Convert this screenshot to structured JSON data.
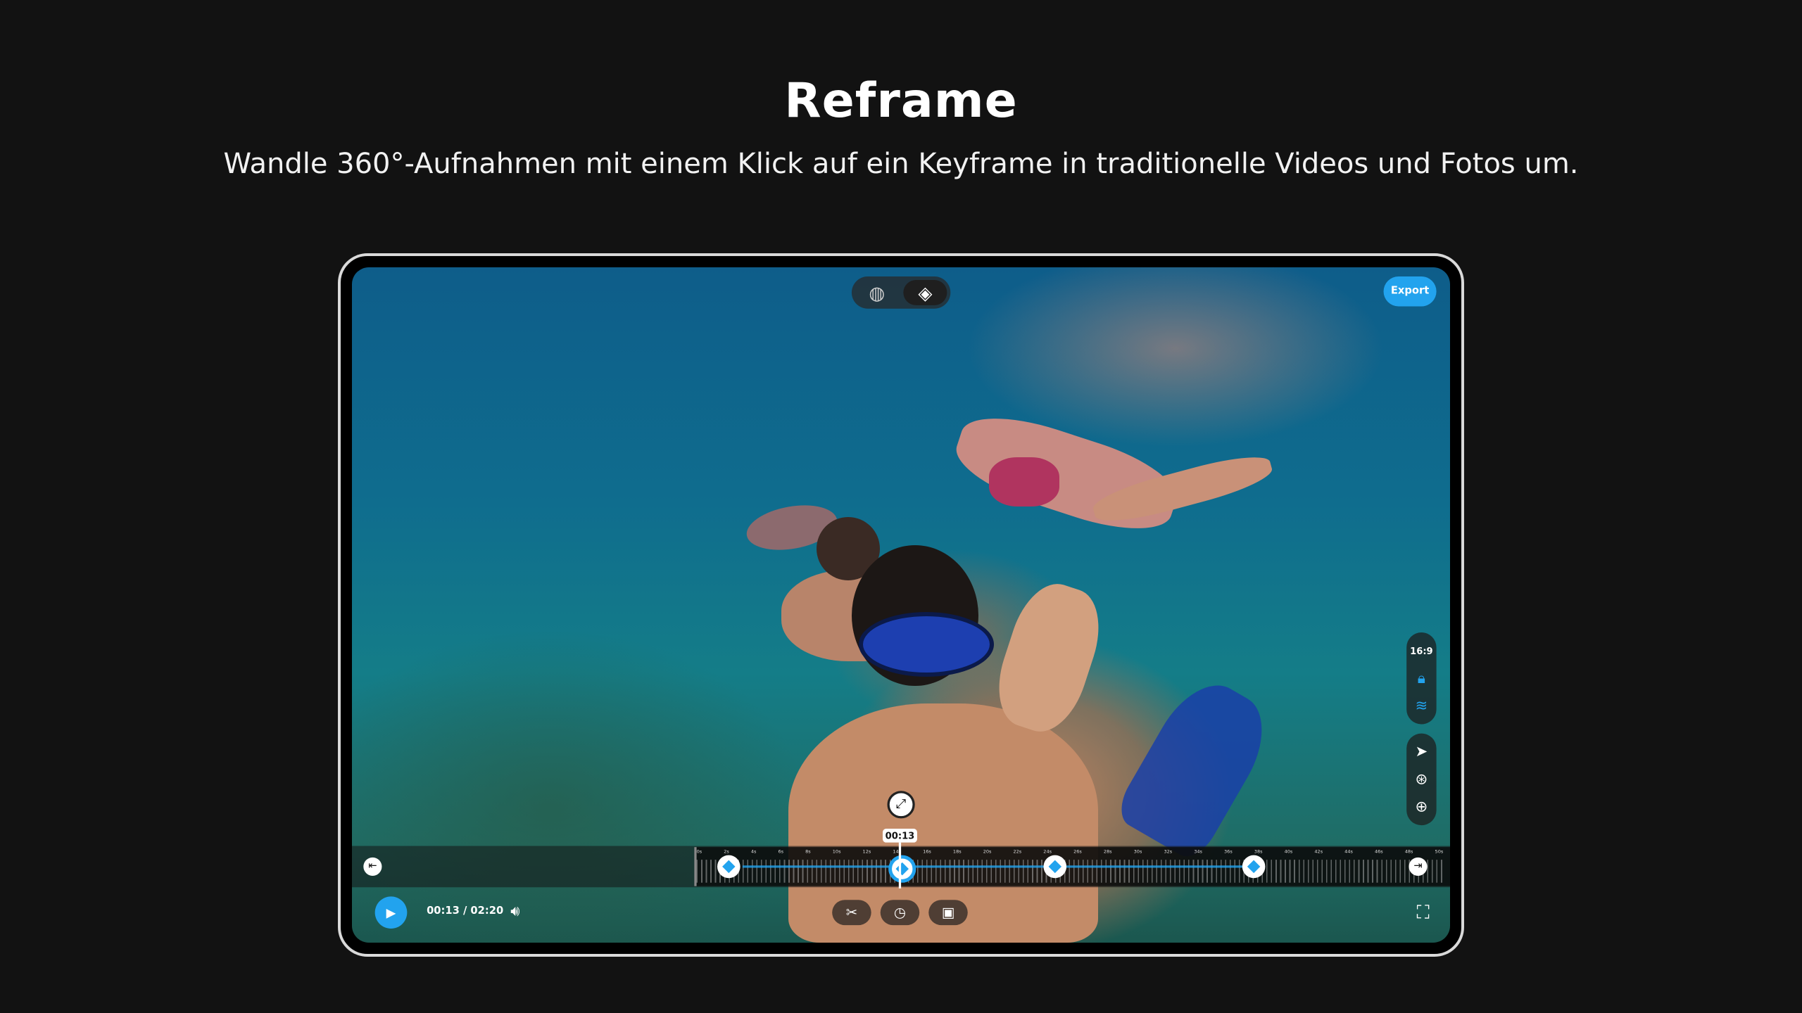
{
  "header": {
    "title": "Reframe",
    "subtitle": "Wandle 360°-Aufnahmen mit einem Klick auf ein Keyframe in traditionelle Videos und Fotos um."
  },
  "player": {
    "export_label": "Export",
    "view_toggle": {
      "icons": [
        "globe-icon",
        "keyframe-icon"
      ],
      "active": "keyframe-icon"
    },
    "tools": {
      "ratio_label": "16:9",
      "icons": [
        "lock-icon",
        "horizon-icon",
        "cursor-icon",
        "rotate-view-icon",
        "zoom-icon"
      ]
    },
    "timeline": {
      "ruler_labels": [
        "0s",
        "2s",
        "4s",
        "6s",
        "8s",
        "10s",
        "12s",
        "14s",
        "16s",
        "18s",
        "20s",
        "22s",
        "24s",
        "26s",
        "28s",
        "30s",
        "32s",
        "34s",
        "36s",
        "38s",
        "40s",
        "42s",
        "44s",
        "46s",
        "48s",
        "50s"
      ],
      "playhead_label": "00:13",
      "keyframe_count": 4
    },
    "controls": {
      "time": "00:13 / 02:20",
      "center_tools": [
        "scissors-icon",
        "speed-icon",
        "snapshot-icon"
      ]
    },
    "accent_color": "#22a3ee"
  }
}
